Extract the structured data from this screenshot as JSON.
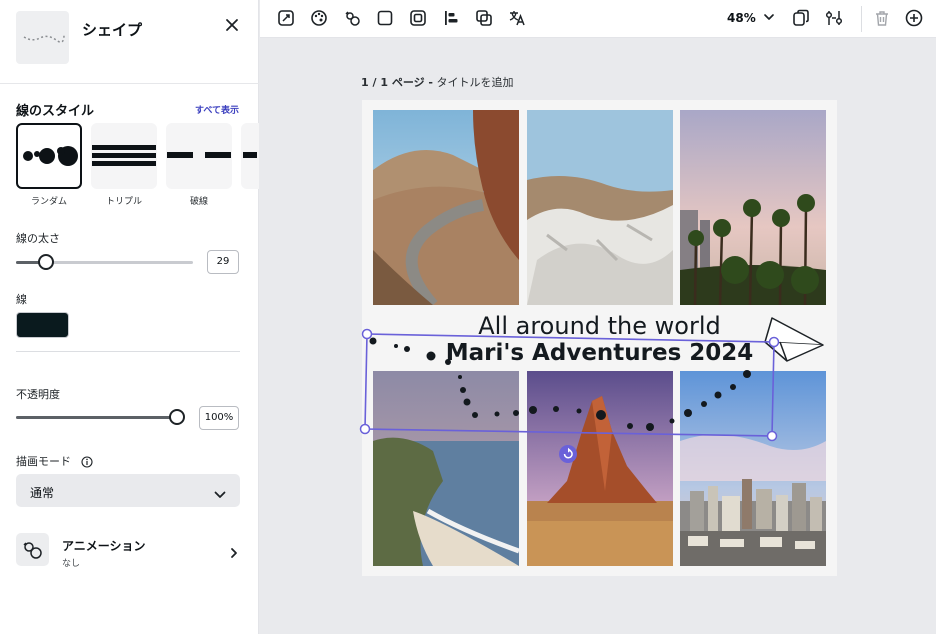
{
  "sidebar": {
    "title": "シェイプ",
    "line_style": {
      "title": "線のスタイル",
      "show_all": "すべて表示",
      "options": [
        {
          "label": "ランダム",
          "selected": true
        },
        {
          "label": "トリプル",
          "selected": false
        },
        {
          "label": "破線",
          "selected": false
        },
        {
          "label": "",
          "selected": false
        }
      ]
    },
    "line_width": {
      "label": "線の太さ",
      "value": "29",
      "level": 0.17
    },
    "line": {
      "label": "線",
      "color": "#0a1a1e"
    },
    "opacity": {
      "label": "不透明度",
      "value": "100%",
      "level": 1.0
    },
    "blend_mode": {
      "label": "描画モード",
      "value": "通常"
    },
    "animation": {
      "title": "アニメーション",
      "subtitle": "なし"
    }
  },
  "toolbar": {
    "icons": [
      "crop-icon",
      "color-palette-icon",
      "animation-icon",
      "square-icon",
      "border-icon",
      "align-icon",
      "layers-icon",
      "translate-icon",
      "chevron-down-icon",
      "copy-icon",
      "adjust-icon",
      "trash-icon",
      "add-icon"
    ],
    "zoom": "48%"
  },
  "canvas": {
    "page_number": "1 / 1 ページ -",
    "page_title_placeholder": "タイトルを追加",
    "caption_line1": "All around the world",
    "caption_line2": "Mari's Adventures 2024"
  },
  "colors": {
    "accent": "#6a61d9",
    "link": "#3b3fbf"
  }
}
